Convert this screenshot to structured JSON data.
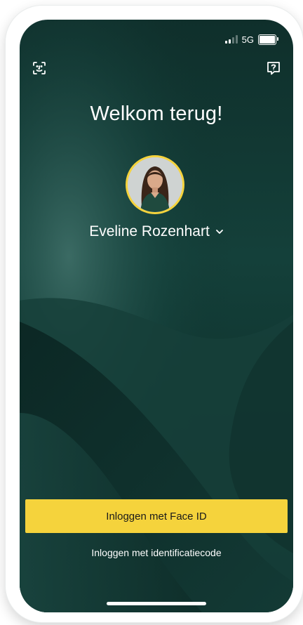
{
  "status_bar": {
    "network": "5G",
    "battery_level": 1.0
  },
  "header": {
    "title": "Welkom terug!"
  },
  "icons": {
    "scan": "face-scan-icon",
    "help": "help-icon",
    "chevron": "chevron-down-icon"
  },
  "user": {
    "name": "Eveline Rozenhart"
  },
  "actions": {
    "face_id_label": "Inloggen met Face ID",
    "code_label": "Inloggen met identificatiecode"
  },
  "colors": {
    "accent": "#f5d33c",
    "background": "#14403a",
    "text": "#ffffff"
  }
}
